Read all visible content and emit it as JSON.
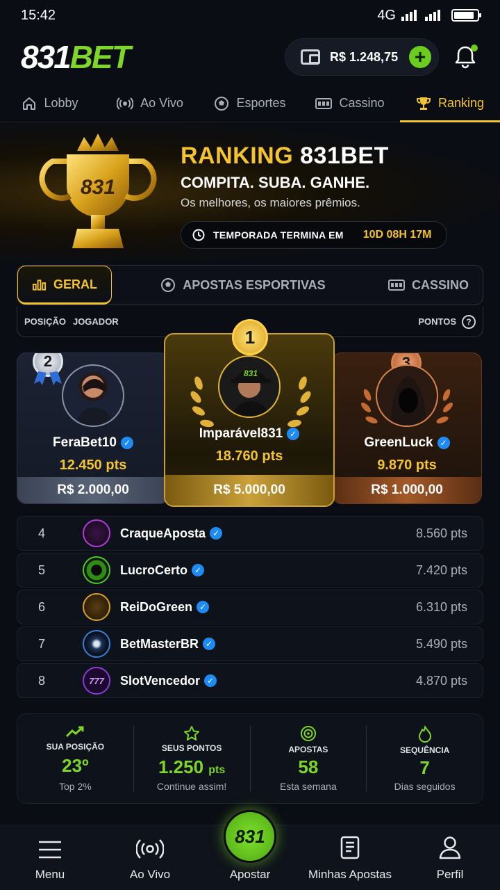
{
  "status": {
    "time": "15:42",
    "network": "4G"
  },
  "header": {
    "logo_left": "831",
    "logo_right": "BET",
    "balance": "R$ 1.248,75"
  },
  "nav_tabs": [
    {
      "label": "Lobby",
      "icon": "home-icon"
    },
    {
      "label": "Ao Vivo",
      "icon": "live-icon"
    },
    {
      "label": "Esportes",
      "icon": "soccer-ball-icon"
    },
    {
      "label": "Cassino",
      "icon": "slot-machine-icon"
    },
    {
      "label": "Ranking",
      "icon": "trophy-icon",
      "active": true
    }
  ],
  "hero": {
    "title_gold": "RANKING",
    "title_white": "831BET",
    "subtitle": "COMPITA. SUBA. GANHE.",
    "description": "Os melhores, os maiores prêmios.",
    "countdown_label": "TEMPORADA TERMINA EM",
    "countdown_value": "10D 08H 17M",
    "trophy_text": "831"
  },
  "category_tabs": [
    {
      "label": "GERAL",
      "icon": "bar-chart-icon",
      "active": true
    },
    {
      "label": "APOSTAS ESPORTIVAS",
      "icon": "soccer-ball-icon"
    },
    {
      "label": "CASSINO",
      "icon": "slot-machine-icon"
    }
  ],
  "columns": {
    "position": "POSIÇÃO",
    "player": "JOGADOR",
    "points": "PONTOS"
  },
  "podium": [
    {
      "rank": "2",
      "name": "FeraBet10",
      "points": "12.450 pts",
      "prize": "R$ 2.000,00"
    },
    {
      "rank": "1",
      "name": "Imparável831",
      "points": "18.760 pts",
      "prize": "R$ 5.000,00",
      "cap_text": "831"
    },
    {
      "rank": "3",
      "name": "GreenLuck",
      "points": "9.870 pts",
      "prize": "R$ 1.000,00"
    }
  ],
  "ranking": [
    {
      "pos": "4",
      "name": "CraqueAposta",
      "points": "8.560 pts",
      "color": "#b13cd6"
    },
    {
      "pos": "5",
      "name": "LucroCerto",
      "points": "7.420 pts",
      "color": "#4fc62a"
    },
    {
      "pos": "6",
      "name": "ReiDoGreen",
      "points": "6.310 pts",
      "color": "#d6a227"
    },
    {
      "pos": "7",
      "name": "BetMasterBR",
      "points": "5.490 pts",
      "color": "#3a7fd6"
    },
    {
      "pos": "8",
      "name": "SlotVencedor",
      "points": "4.870 pts",
      "color": "#8a3cd6",
      "avatar_text": "777"
    }
  ],
  "stats": [
    {
      "label": "SUA POSIÇÃO",
      "value": "23º",
      "unit": "",
      "sub": "Top 2%",
      "icon": "trending-up-icon"
    },
    {
      "label": "SEUS PONTOS",
      "value": "1.250",
      "unit": "pts",
      "sub": "Continue assim!",
      "icon": "star-icon"
    },
    {
      "label": "APOSTAS",
      "value": "58",
      "unit": "",
      "sub": "Esta semana",
      "icon": "target-icon"
    },
    {
      "label": "SEQUÊNCIA",
      "value": "7",
      "unit": "",
      "sub": "Dias seguidos",
      "icon": "flame-icon"
    }
  ],
  "bottom_nav": [
    {
      "label": "Menu",
      "icon": "menu-icon"
    },
    {
      "label": "Ao Vivo",
      "icon": "live-icon"
    },
    {
      "label": "Apostar",
      "icon": "bet-icon",
      "badge": "831"
    },
    {
      "label": "Minhas Apostas",
      "icon": "bet-slip-icon"
    },
    {
      "label": "Perfil",
      "icon": "user-icon"
    }
  ],
  "colors": {
    "accent_gold": "#f4c430",
    "accent_green": "#7fd62a",
    "background": "#0a0d14"
  }
}
